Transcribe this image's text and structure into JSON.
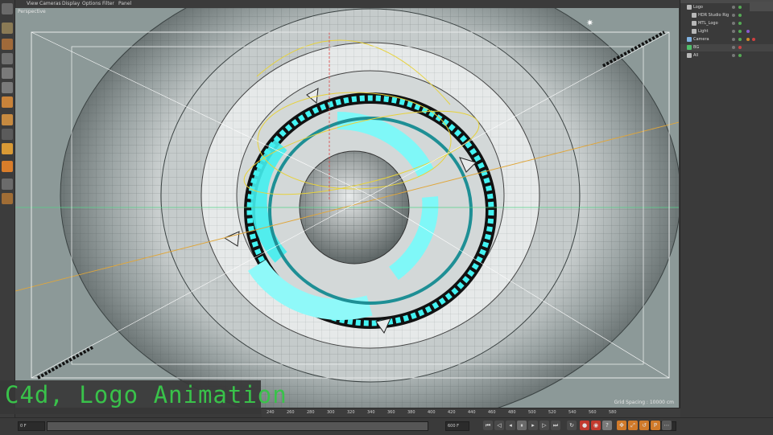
{
  "viewport": {
    "menu": [
      "View",
      "Cameras",
      "Display",
      "Options",
      "Filter",
      "Panel"
    ],
    "label": "Perspective",
    "grid_spacing": "Grid Spacing : 10000 cm"
  },
  "objects": [
    {
      "name": "Logo",
      "indent": 0,
      "color": "#d4d4d4"
    },
    {
      "name": "HDR Studio Rig",
      "indent": 1,
      "color": "#d4d4d4"
    },
    {
      "name": "MTL_Logo",
      "indent": 1,
      "color": "#d4d4d4"
    },
    {
      "name": "Light",
      "indent": 1,
      "color": "#d4d4d4"
    },
    {
      "name": "Camera",
      "indent": 0,
      "color": "#d4d4d4"
    },
    {
      "name": "BG",
      "indent": 0,
      "color": "#d4d4d4"
    },
    {
      "name": "All",
      "indent": 0,
      "color": "#d4d4d4"
    }
  ],
  "overlay_title": "C4d, Logo Animation",
  "timeline": {
    "ticks": [
      "240",
      "260",
      "280",
      "300",
      "320",
      "340",
      "360",
      "380",
      "400",
      "420",
      "440",
      "460",
      "480",
      "500",
      "520",
      "540",
      "560",
      "580"
    ],
    "current_frame": "0 F",
    "start_frame": "0 F",
    "end_frame": "600 F",
    "frame_right": "0 F"
  },
  "colors": {
    "accent_cyan": "#3ff0f0",
    "title_green": "#39c24a",
    "spline_yellow": "#e7d23b"
  }
}
